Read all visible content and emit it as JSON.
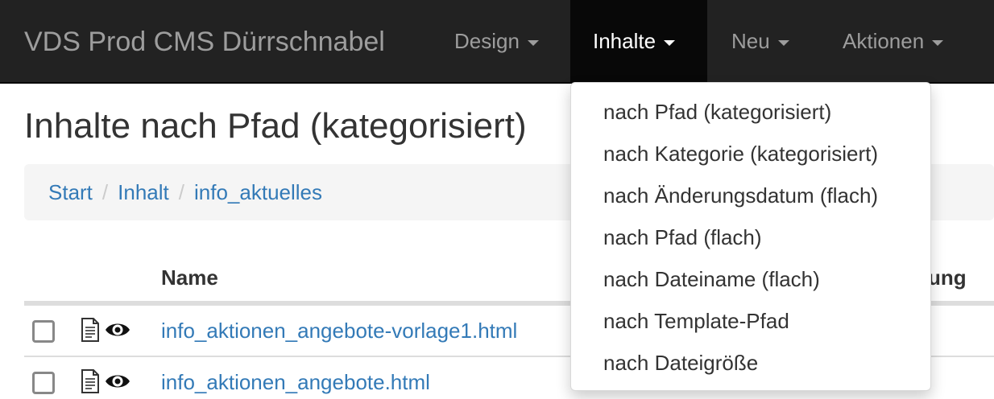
{
  "navbar": {
    "brand": "VDS Prod CMS Dürrschnabel",
    "items": [
      {
        "label": "Design"
      },
      {
        "label": "Inhalte"
      },
      {
        "label": "Neu"
      },
      {
        "label": "Aktionen"
      }
    ]
  },
  "page": {
    "title": "Inhalte nach Pfad (kategorisiert)"
  },
  "breadcrumb": {
    "items": [
      "Start",
      "Inhalt",
      "info_aktuelles"
    ],
    "separator": "/"
  },
  "table": {
    "headers": [
      "Name",
      "ung"
    ],
    "rows": [
      {
        "filename": "info_aktionen_angebote-vorlage1.html"
      },
      {
        "filename": "info_aktionen_angebote.html"
      }
    ]
  },
  "dropdown": {
    "items": [
      "nach Pfad (kategorisiert)",
      "nach Kategorie (kategorisiert)",
      "nach Änderungsdatum (flach)",
      "nach Pfad (flach)",
      "nach Dateiname (flach)",
      "nach Template-Pfad",
      "nach Dateigröße"
    ]
  },
  "icons": {
    "document": "document-icon",
    "eye": "eye-icon",
    "caret": "caret-down-icon"
  },
  "colors": {
    "navbar_bg": "#222222",
    "active_bg": "#080808",
    "link": "#337ab7",
    "breadcrumb_bg": "#f5f5f5"
  }
}
